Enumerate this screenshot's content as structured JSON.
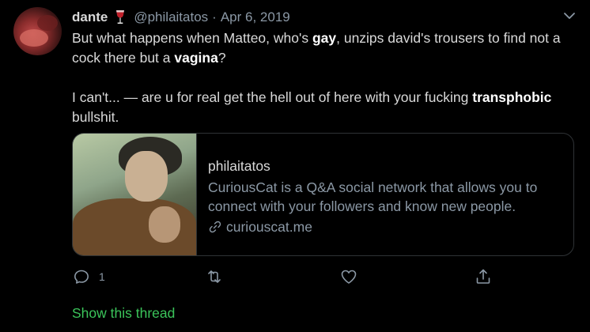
{
  "tweet": {
    "author_name": "dante",
    "handle": "@philaitatos",
    "separator": "·",
    "date": "Apr 6, 2019",
    "body": {
      "p1_a": "But what happens when Matteo, who's ",
      "p1_b": "gay",
      "p1_c": ", unzips david's trousers to find not a cock there but a ",
      "p1_d": "vagina",
      "p1_e": "?",
      "p2_a": "I can't... — are u for real get the hell out of here with your fucking ",
      "p2_b": "transphobic",
      "p2_c": " bullshit."
    },
    "card": {
      "title": "philaitatos",
      "description": "CuriousCat is a Q&A social network that allows you to connect with your followers and know new people.",
      "link": "curiouscat.me"
    },
    "actions": {
      "reply_count": "1",
      "retweet_count": "",
      "like_count": ""
    },
    "show_thread": "Show this thread"
  },
  "colors": {
    "background": "#000000",
    "text": "#d9d9d9",
    "secondary": "#8b98a5",
    "accent_green": "#3bc45a",
    "border": "#2f3336"
  },
  "icons": {
    "name_emoji": "wine-glass-icon",
    "menu": "chevron-down-icon",
    "reply": "reply-icon",
    "retweet": "retweet-icon",
    "like": "heart-icon",
    "share": "share-icon",
    "card_link": "link-icon"
  }
}
